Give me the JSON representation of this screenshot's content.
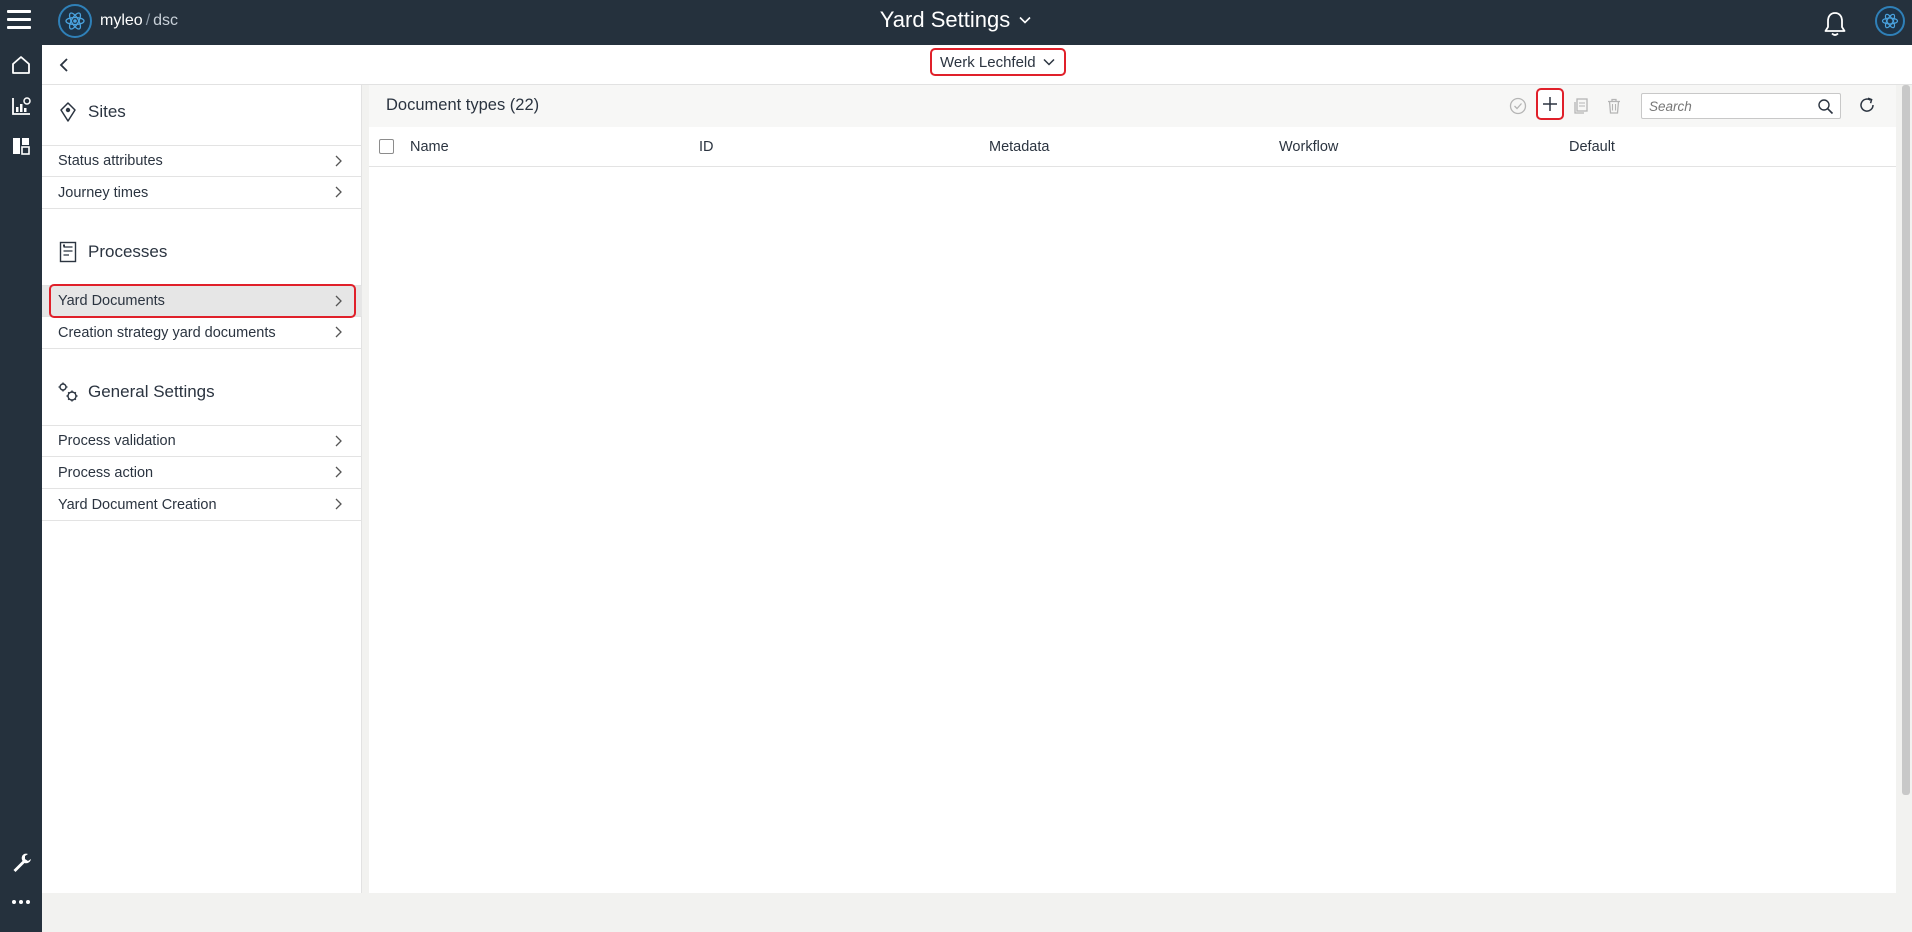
{
  "app": {
    "brand_name": "myleo",
    "brand_separator": "/",
    "brand_product": "dsc",
    "title": "Yard Settings"
  },
  "subheader": {
    "site": "Werk Lechfeld"
  },
  "sidebar": {
    "sections": [
      {
        "title": "Sites",
        "icon": "location-pin-icon",
        "items": [
          "Status attributes",
          "Journey times"
        ]
      },
      {
        "title": "Processes",
        "icon": "document-icon",
        "items": [
          "Yard Documents",
          "Creation strategy yard documents"
        ]
      },
      {
        "title": "General Settings",
        "icon": "gears-icon",
        "items": [
          "Process validation",
          "Process action",
          "Yard Document Creation"
        ]
      }
    ],
    "selected_item": "Yard Documents"
  },
  "main": {
    "title": "Document types (22)",
    "search_placeholder": "Search",
    "columns": [
      "Name",
      "ID",
      "Metadata",
      "Workflow",
      "Default"
    ],
    "rows": []
  },
  "colors": {
    "topbar": "#25313d",
    "highlight": "#e0202a",
    "accent": "#2f80b8"
  }
}
